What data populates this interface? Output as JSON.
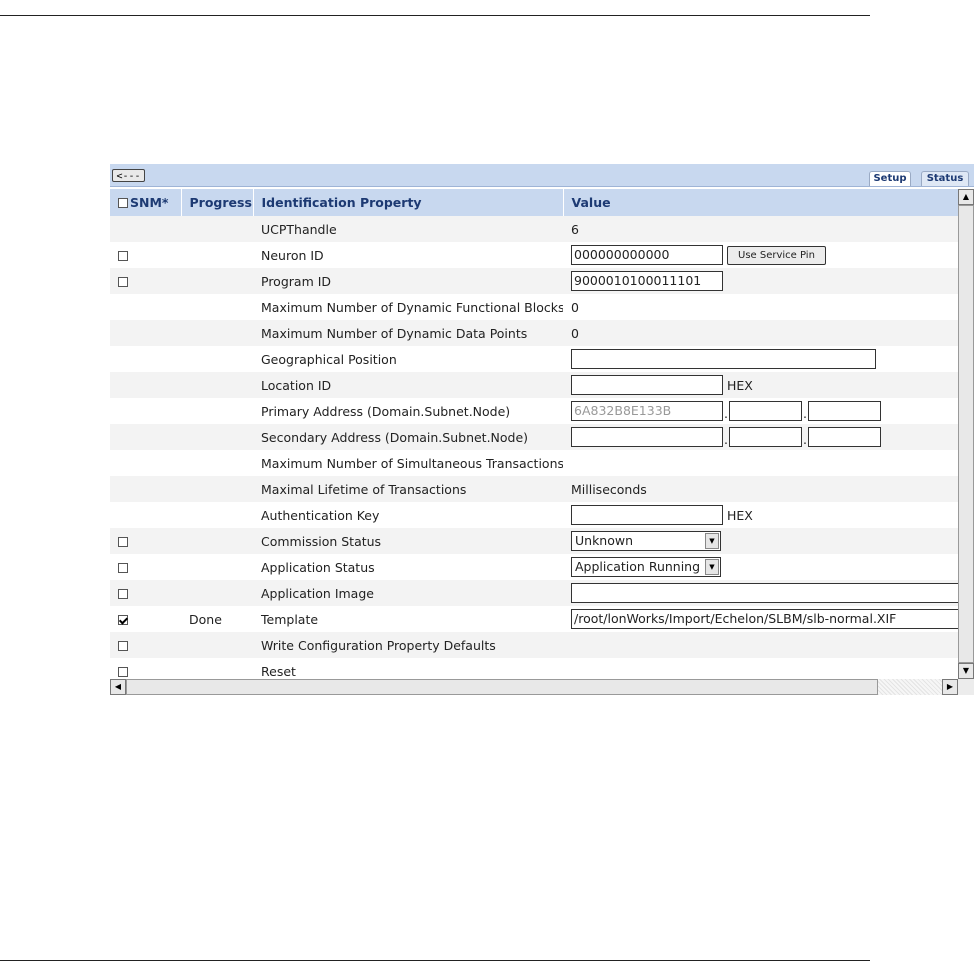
{
  "toolbar": {
    "back_label": "<---",
    "tabs": [
      {
        "label": "Setup",
        "active": true
      },
      {
        "label": "Status",
        "active": false
      }
    ]
  },
  "columns": {
    "snm": "SNM*",
    "progress": "Progress",
    "property": "Identification Property",
    "value": "Value"
  },
  "rows": [
    {
      "property": "UCPThandle",
      "value": "6",
      "progress": ""
    },
    {
      "property": "Neuron ID",
      "value": "000000000000",
      "button": "Use Service Pin"
    },
    {
      "property": "Program ID",
      "value": "9000010100011101"
    },
    {
      "property": "Maximum Number of Dynamic Functional Blocks",
      "value": "0"
    },
    {
      "property": "Maximum Number of Dynamic Data Points",
      "value": "0"
    },
    {
      "property": "Geographical Position",
      "value": ""
    },
    {
      "property": "Location ID",
      "value": "",
      "unit": "HEX"
    },
    {
      "property": "Primary Address (Domain.Subnet.Node)",
      "domain": "6A832B8E133B",
      "subnet": "",
      "node": ""
    },
    {
      "property": "Secondary Address (Domain.Subnet.Node)",
      "domain": "",
      "subnet": "",
      "node": ""
    },
    {
      "property": "Maximum Number of Simultaneous Transactions",
      "value": ""
    },
    {
      "property": "Maximal Lifetime of Transactions",
      "value": "Milliseconds"
    },
    {
      "property": "Authentication Key",
      "value": "",
      "unit": "HEX"
    },
    {
      "property": "Commission Status",
      "selected": "Unknown",
      "snm_checked": false
    },
    {
      "property": "Application Status",
      "selected": "Application Running",
      "snm_checked": false
    },
    {
      "property": "Application Image",
      "value": "",
      "snm_checked": false
    },
    {
      "property": "Template",
      "value": "/root/lonWorks/Import/Echelon/SLBM/slb-normal.XIF",
      "progress": "Done",
      "snm_checked": true
    },
    {
      "property": "Write Configuration Property Defaults",
      "snm_checked": false
    },
    {
      "property": "Reset",
      "snm_checked": false
    }
  ],
  "colors": {
    "header_bg": "#c8d8ef",
    "header_text": "#1d3a73",
    "row_alt": "#f3f3f3"
  }
}
